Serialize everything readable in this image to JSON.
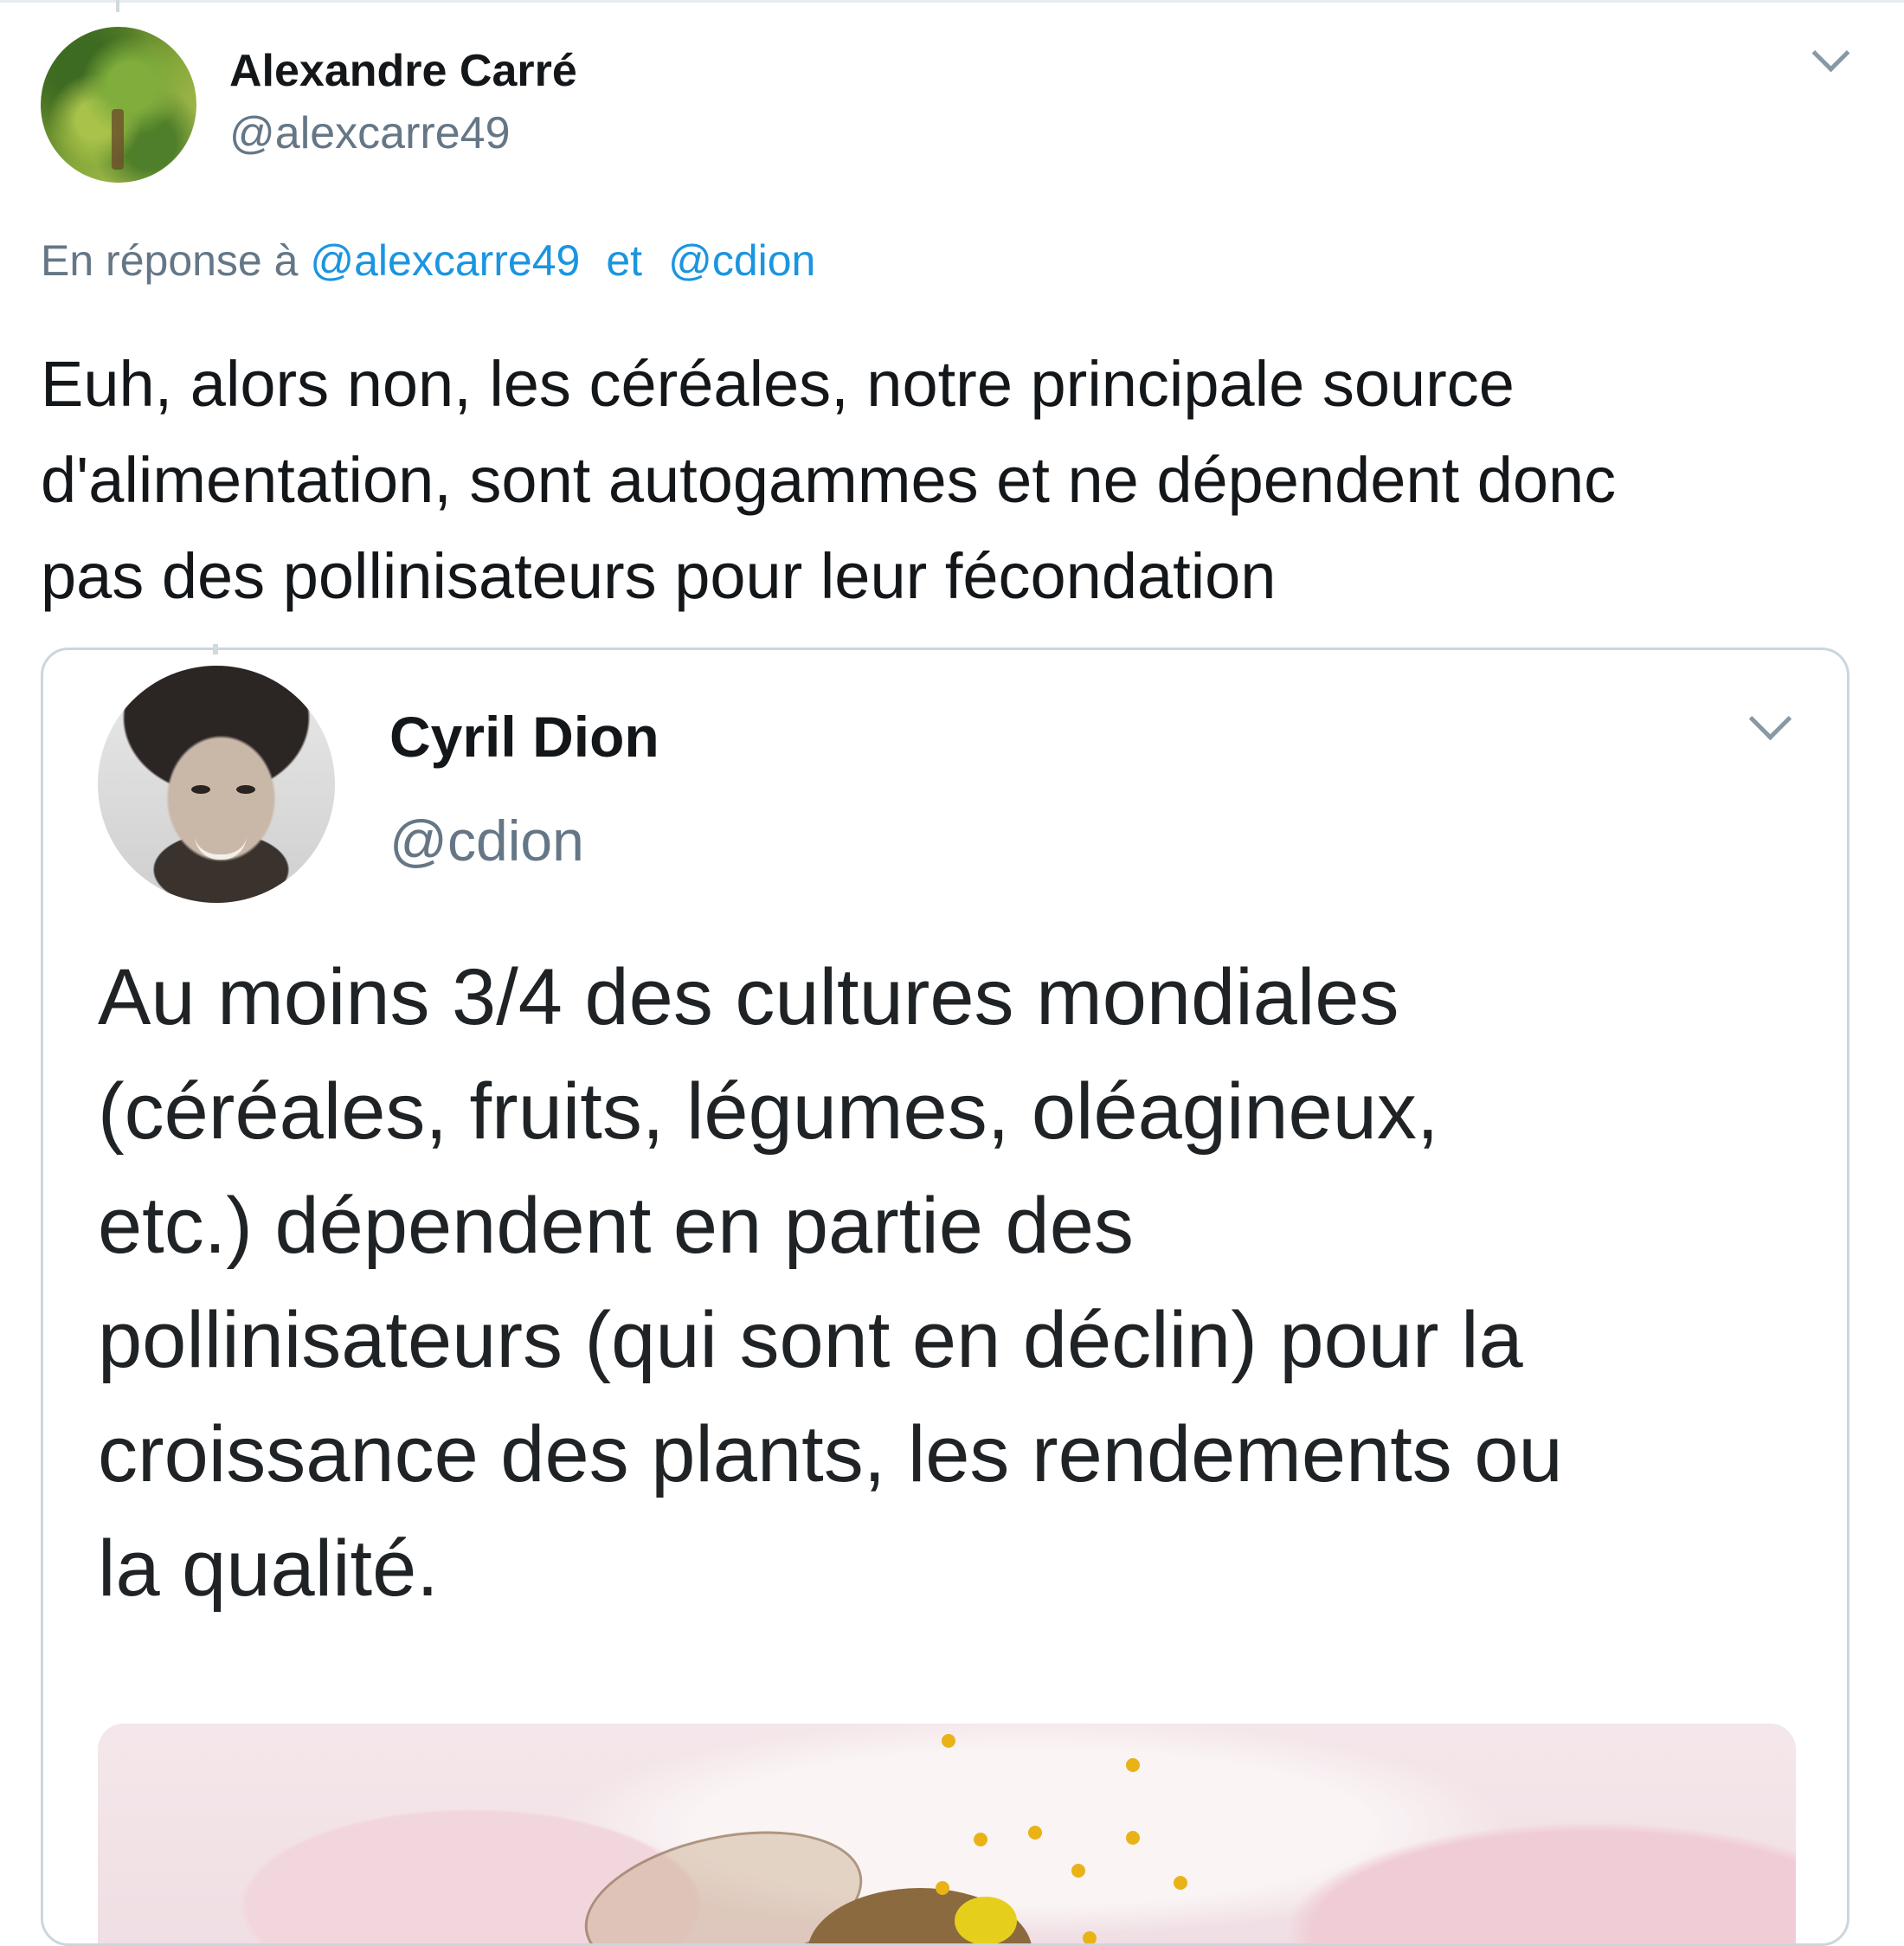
{
  "tweet": {
    "author_name": "Alexandre Carré",
    "author_handle": "@alexcarre49",
    "reply_prefix": "En réponse à",
    "reply_mention_1": "@alexcarre49",
    "reply_conjunction": "et",
    "reply_mention_2": "@cdion",
    "text_lines": [
      "Euh, alors non, les céréales, notre principale source",
      "d'alimentation, sont autogammes et ne dépendent donc",
      "pas des pollinisateurs pour leur fécondation"
    ],
    "menu_icon": "chevron-down-icon"
  },
  "quoted_tweet": {
    "author_name": "Cyril Dion",
    "author_handle": "@cdion",
    "text_lines": [
      "Au moins 3/4 des cultures mondiales",
      "(céréales, fruits, légumes, oléagineux,",
      "etc.) dépendent en partie des",
      "pollinisateurs (qui sont en déclin) pour la",
      "croissance des plants, les rendements ou",
      "la qualité."
    ],
    "menu_icon": "chevron-down-icon",
    "media": "bee-on-flower-photo"
  },
  "colors": {
    "text": "#14171a",
    "secondary": "#657786",
    "link": "#1b95e0",
    "border": "#ccd6dd"
  }
}
